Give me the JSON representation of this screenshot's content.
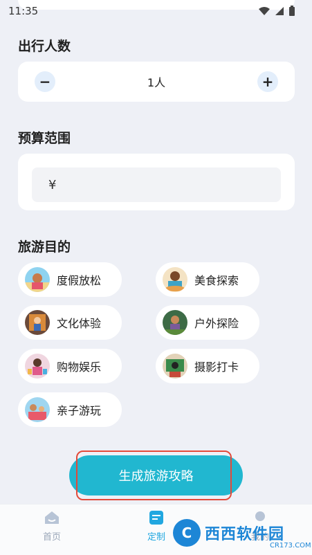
{
  "status_bar": {
    "time": "11:35"
  },
  "travelers": {
    "title": "出行人数",
    "value": "1人",
    "minus": "−",
    "plus": "+"
  },
  "budget": {
    "title": "预算范围",
    "currency_symbol": "¥"
  },
  "purposes": {
    "title": "旅游目的",
    "items": [
      {
        "label": "度假放松",
        "icon": "beach-avatar-icon"
      },
      {
        "label": "美食探索",
        "icon": "food-avatar-icon"
      },
      {
        "label": "文化体验",
        "icon": "culture-avatar-icon"
      },
      {
        "label": "户外探险",
        "icon": "outdoor-avatar-icon"
      },
      {
        "label": "购物娱乐",
        "icon": "shopping-avatar-icon"
      },
      {
        "label": "摄影打卡",
        "icon": "photo-avatar-icon"
      },
      {
        "label": "亲子游玩",
        "icon": "family-avatar-icon"
      }
    ]
  },
  "cta": {
    "label": "生成旅游攻略"
  },
  "bottom_nav": {
    "items": [
      {
        "label": "首页"
      },
      {
        "label": "定制"
      },
      {
        "label": "我的"
      }
    ]
  },
  "watermark": {
    "logo": "C",
    "text": "西西软件园",
    "sub": "CR173.COM"
  },
  "colors": {
    "accent": "#21b7d0",
    "active_nav": "#21a7e0",
    "highlight_border": "#e24a3a",
    "background": "#eef0f6"
  }
}
